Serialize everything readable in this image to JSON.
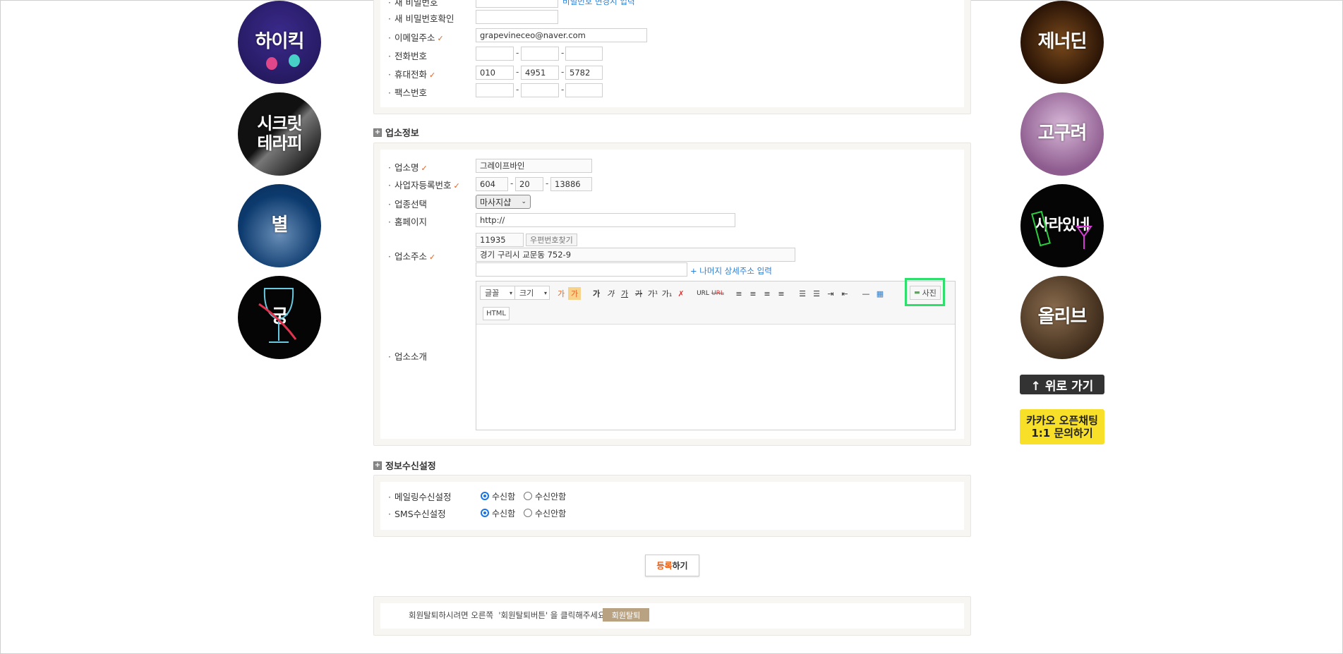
{
  "colors": {
    "accent": "#e6601e",
    "link": "#2a7fd4",
    "highlight": "#2ee06b",
    "withdraw": "#b8a282",
    "kakao": "#f7e027"
  },
  "left_banners": [
    {
      "label": "하이킥"
    },
    {
      "label": "시크릿\n테라피"
    },
    {
      "label": "별"
    },
    {
      "label": "궁"
    }
  ],
  "right_banners": [
    {
      "label": "제너딘"
    },
    {
      "label": "고구려"
    },
    {
      "label": "사라있네"
    },
    {
      "label": "올리브"
    }
  ],
  "top_button": {
    "label": "↑ 위로 가기"
  },
  "kakao_button": {
    "line1": "카카오 오픈채팅",
    "line2": "1:1 문의하기"
  },
  "member": {
    "partial_label": "새 비밀번호",
    "partial_hint": "비밀번호 변경시 입력",
    "confirm_password_label": "새 비밀번호확인",
    "email_label": "이메일주소",
    "email_value": "grapevineceo@naver.com",
    "phone_label": "전화번호",
    "mobile_label": "휴대전화",
    "mobile": [
      "010",
      "4951",
      "5782"
    ],
    "fax_label": "팩스번호"
  },
  "business": {
    "section_title": "업소정보",
    "name_label": "업소명",
    "name_value": "그레이프바인",
    "reg_label": "사업자등록번호",
    "reg": [
      "604",
      "20",
      "13886"
    ],
    "category_label": "업종선택",
    "category_value": "마사지샵",
    "homepage_label": "홈페이지",
    "homepage_value": "http://",
    "address_label": "업소주소",
    "zip": "11935",
    "zip_button": "우편번호찾기",
    "address_value": "경기 구리시 교문동 752-9",
    "detail_link": "+ 나머지 상세주소 입력",
    "intro_label": "업소소개",
    "editor": {
      "font": "글꼴",
      "size": "크기",
      "fg": "가",
      "bg": "가",
      "bold": "가",
      "italic": "가",
      "underline": "가",
      "strike": "가",
      "sup": "가¹",
      "sub": "가₁",
      "url": "URL",
      "unlink": "URL",
      "photo": "사진",
      "html": "HTML"
    }
  },
  "receive": {
    "section_title": "정보수신설정",
    "mail_label": "메일링수신설정",
    "sms_label": "SMS수신설정",
    "yes": "수신함",
    "no": "수신안함"
  },
  "submit": {
    "accent": "등록",
    "rest": "하기"
  },
  "withdraw": {
    "text": "회원탈퇴하시려면 오른쪽  '회원탈퇴버튼' 을 클릭해주세요.",
    "button": "회원탈퇴"
  }
}
